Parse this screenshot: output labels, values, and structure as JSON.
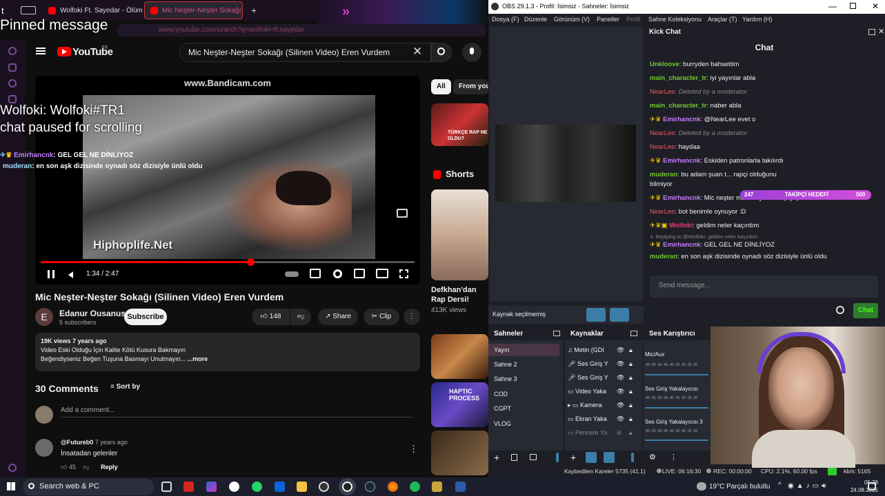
{
  "browser": {
    "tabs": [
      {
        "label": "Wolfoki Ft. Sayedar - Ölüm Yok"
      },
      {
        "label": "Mic Neşter-Neşter Sokağı (S"
      }
    ],
    "url": "www.youtube.com/search?q=wolfoki+ft.sayedar",
    "pinned_overlay": "Pinned message"
  },
  "youtube": {
    "logo_text": "YouTube",
    "logo_country": "TR",
    "search_value": "Mic Neşter-Neşter Sokağı (Silinen Video) Eren Vurdem",
    "player": {
      "watermark": "www.Bandicam.com",
      "burned_text": "Hiphoplife.Net",
      "time": "1:34 / 2:47",
      "progress": 0.56
    },
    "chat_overlay": {
      "line1": "Wolfoki: Wolfoki#TR1",
      "line2": "chat paused for scrolling",
      "msg1_user": "Emirhancnk",
      "msg1_text": ": GEL GEL NE DİNLİYOZ",
      "msg2_user": "muderan",
      "msg2_text": ": en son aşk dizisinde oynadı söz dizisiyle ünlü oldu"
    },
    "video_title": "Mic Neşter-Neşter Sokağı (Silinen Video) Eren Vurdem",
    "channel": {
      "initial": "E",
      "name": "Edanur Ousanus",
      "subscribers": "5 subscribers",
      "subscribe_label": "Subscribe"
    },
    "actions": {
      "likes": "148",
      "share": "Share",
      "clip": "Clip",
      "more": "⋮"
    },
    "description": {
      "stats": "19K views  7 years ago",
      "line1": "Video Eski Olduğu İçin Kalite Kötü Kusura Bakmayın",
      "line2": "Beğendiyseniz Beğen Tuşuna Basmayı Unutmayın...",
      "more": "...more"
    },
    "comments": {
      "count_label": "30 Comments",
      "sort_label": "Sort by",
      "placeholder": "Add a comment...",
      "first": {
        "user": "@Futureb0",
        "age": "7 years ago",
        "text": "İnsatadan gelenler",
        "likes": "45",
        "reply": "Reply"
      }
    },
    "sidebar": {
      "chip_all": "All",
      "chip_from": "From your",
      "thumb1_text": "TÜRKÇE RAP NE OLDU?",
      "shorts_label": "Shorts",
      "short_title_1": "Defkhan'dan",
      "short_title_2": "Rap Dersi!",
      "short_views": "413K views",
      "thumb_haptic": "HAPTIC PROCESS"
    }
  },
  "obs": {
    "title": "OBS 29.1.3 - Profil: İsimsiz - Sahneler: İsimsiz",
    "menu": [
      "Dosya (F)",
      "Düzenle",
      "Görünüm (V)",
      "Paneller",
      "Profil",
      "Sahne Koleksiyonu",
      "Araçlar (T)",
      "Yardım (H)"
    ],
    "no_source": "Kaynak seçilmemiş",
    "scenes_header": "Sahneler",
    "scenes": [
      "Yayın",
      "Sahne 2",
      "Sahne 3",
      "COD",
      "CGPT",
      "VLOG"
    ],
    "sources_header": "Kaynaklar",
    "sources": [
      "Metin (GDI",
      "Ses Giriş Y",
      "Ses Giriş Y",
      "Video Yaka",
      "Kamera",
      "Ekran Yaka",
      "Pencere Ya"
    ],
    "mixer_header": "Ses Karıştırıcı",
    "mixer_channels": [
      "Mic/Aux",
      "Ses Giriş Yakalayıcısı",
      "Ses Giriş Yakalayıcısı 3"
    ],
    "mixer_scale": "-60 -55 -50 -45 -40 -35 -30 -25 -20",
    "status": {
      "dropped": "Kaybedilen Kareler 5735 (41.1)",
      "live": "LIVE: 06:16:30",
      "rec": "REC: 00:00:00",
      "cpu": "CPU: 2.1%, 60.00 fps",
      "kbps": "kb/s: 5165"
    }
  },
  "kick": {
    "dock_title": "Kick Chat",
    "chat_header": "Chat",
    "goal_current": "247",
    "goal_label": "TAKİPÇİ HEDEFİ",
    "goal_target": "500",
    "messages": [
      {
        "user": "Unkloove",
        "text": ": burryden bahsettim"
      },
      {
        "user": "main_character_tr",
        "text": ": iyi yayınlar abla"
      },
      {
        "user": "NearLee",
        "text": ": Deleted by a moderator"
      },
      {
        "user": "main_character_tr",
        "text": ": naber abla"
      },
      {
        "user": "Emirhancnk",
        "text": ": @NearLee evet o"
      },
      {
        "user": "NearLee",
        "text": ": Deleted by a moderator"
      },
      {
        "user": "NearLee",
        "text": ": haydaa"
      },
      {
        "user": "Emirhancnk",
        "text": ": Eskiden patronlarla takılırdı"
      },
      {
        "user": "muderan",
        "text": ": bu adam şuan t... rapçi olduğunu"
      },
      {
        "user": "",
        "text": "bilmiyor"
      },
      {
        "user": "Emirhancnk",
        "text": ": Mic neşter mahlasıyla da rap yapardı"
      },
      {
        "user": "NearLee",
        "text": ": bot benimle oynuyor :D"
      },
      {
        "user": "Wolfoki",
        "text": ": geldim neler kaçırdım"
      },
      {
        "user": "",
        "text": "↳ Replying to @Wolfoki: geldim neler kaçırdım"
      },
      {
        "user": "Emirhancnk",
        "text": ": GEL GEL NE DİNLİYOZ"
      },
      {
        "user": "muderan",
        "text": ": en son aşk dizisinde oynadı söz dizisiyle ünlü oldu"
      }
    ],
    "placeholder": "Send message...",
    "send_label": "Chat"
  },
  "taskbar": {
    "search_placeholder": "Search web & PC",
    "weather": "19°C  Parçalı bulutlu",
    "time": "05:28",
    "date": "24.08.2025"
  }
}
